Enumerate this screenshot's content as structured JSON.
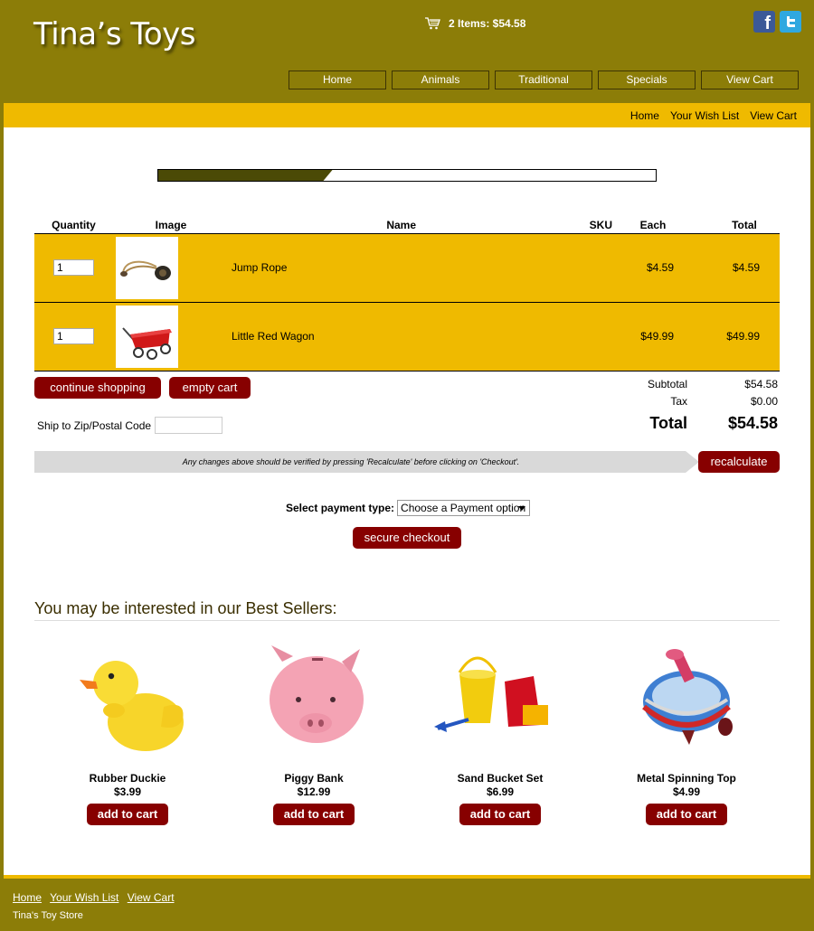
{
  "header": {
    "logo": "Tina’s Toys",
    "cart_summary": "2 Items: $54.58",
    "nav": [
      "Home",
      "Animals",
      "Traditional",
      "Specials",
      "View Cart"
    ]
  },
  "subnav": [
    "Home",
    "Your Wish List",
    "View Cart"
  ],
  "checkout_progress": 0.35,
  "cart": {
    "columns": [
      "Quantity",
      "Image",
      "Name",
      "SKU",
      "Each",
      "Total"
    ],
    "items": [
      {
        "qty": "1",
        "name": "Jump Rope",
        "sku": "",
        "each": "$4.59",
        "total": "$4.59",
        "image_icon": "jump-rope-icon"
      },
      {
        "qty": "1",
        "name": "Little Red Wagon",
        "sku": "",
        "each": "$49.99",
        "total": "$49.99",
        "image_icon": "red-wagon-icon"
      }
    ],
    "continue_label": "continue shopping",
    "empty_label": "empty cart",
    "zip_label": "Ship to Zip/Postal Code",
    "zip_value": "",
    "totals": {
      "subtotal_label": "Subtotal",
      "subtotal": "$54.58",
      "tax_label": "Tax",
      "tax": "$0.00",
      "total_label": "Total",
      "total": "$54.58"
    },
    "notice": "Any changes above should be verified by pressing 'Recalculate' before clicking on 'Checkout'.",
    "recalculate_label": "recalculate"
  },
  "payment": {
    "label": "Select payment type:",
    "selected": "Choose a Payment option",
    "checkout_label": "secure checkout"
  },
  "best_sellers": {
    "title": "You may be interested in our Best Sellers:",
    "add_label": "add to cart",
    "products": [
      {
        "name": "Rubber Duckie",
        "price": "$3.99",
        "icon": "rubber-duck-icon"
      },
      {
        "name": "Piggy Bank",
        "price": "$12.99",
        "icon": "piggy-bank-icon"
      },
      {
        "name": "Sand Bucket Set",
        "price": "$6.99",
        "icon": "sand-bucket-icon"
      },
      {
        "name": "Metal Spinning Top",
        "price": "$4.99",
        "icon": "spinning-top-icon"
      }
    ]
  },
  "footer": {
    "links": [
      "Home",
      "Your Wish List",
      "View Cart"
    ],
    "store_name": "Tina's Toy Store"
  },
  "colors": {
    "olive": "#8c7d08",
    "gold": "#efba00",
    "button_red": "#870000"
  }
}
